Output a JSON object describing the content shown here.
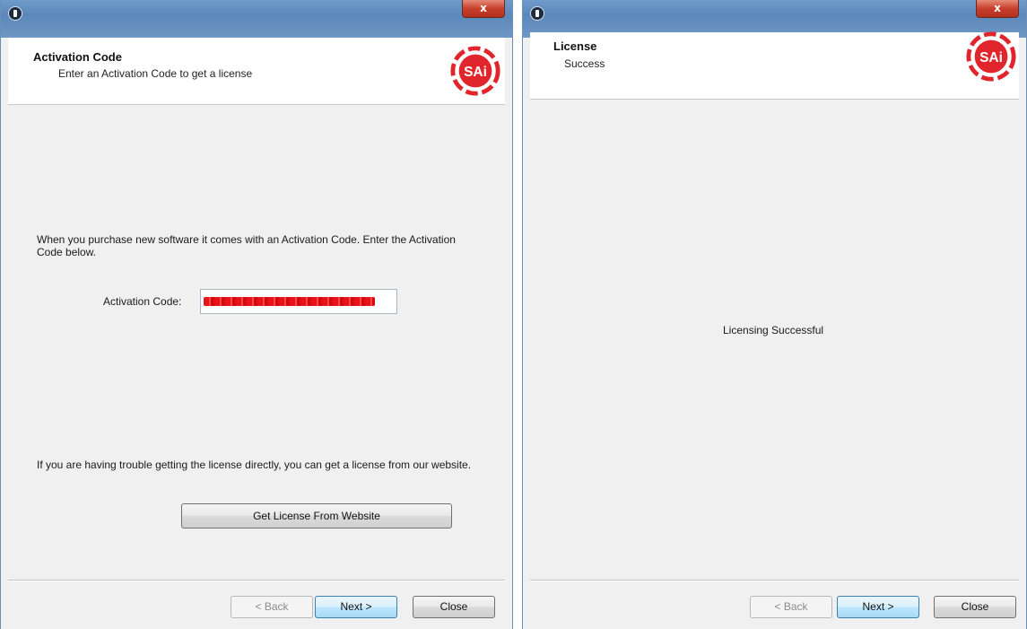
{
  "left_window": {
    "close_label": "x",
    "header": {
      "title": "Activation Code",
      "subtitle": "Enter an Activation Code to get a license",
      "logo_text": "SAi"
    },
    "intro_text": "When you purchase new software it comes with an Activation Code.  Enter the Activation Code below.",
    "activation_field": {
      "label": "Activation Code:",
      "value_state": "redacted"
    },
    "trouble_text": "If you are having trouble getting the license directly, you can get a license from our website.",
    "website_button": "Get License From Website",
    "footer": {
      "back": "< Back",
      "next": "Next >",
      "close": "Close"
    }
  },
  "right_window": {
    "close_label": "x",
    "header": {
      "title": "License",
      "subtitle": "Success",
      "logo_text": "SAi"
    },
    "message": "Licensing Successful",
    "footer": {
      "back": "< Back",
      "next": "Next >",
      "close": "Close"
    }
  },
  "colors": {
    "title_bar": "#5b88bb",
    "close_button": "#c8402c",
    "logo_red": "#e0262c",
    "dialog_bg": "#f0f0f0",
    "default_button": "#bee6fd"
  },
  "icons": {
    "window_icon": "download-circle-icon",
    "logo": "sai-logo"
  }
}
